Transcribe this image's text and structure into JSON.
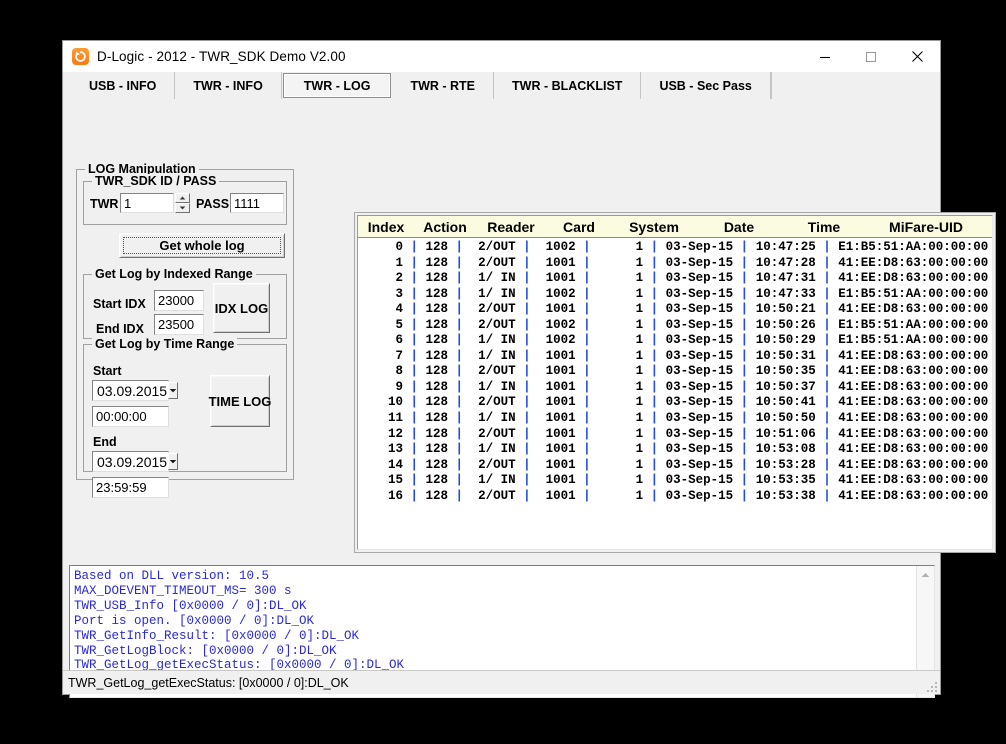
{
  "window": {
    "title": "D-Logic - 2012  - TWR_SDK Demo V2.00",
    "icon": "refresh-circle-icon",
    "minimize_label": "minimize-icon",
    "maximize_label": "maximize-icon",
    "close_label": "close-icon"
  },
  "tabs": [
    {
      "label": "USB - INFO",
      "selected": false
    },
    {
      "label": "TWR - INFO",
      "selected": false
    },
    {
      "label": "TWR - LOG",
      "selected": true
    },
    {
      "label": "TWR - RTE",
      "selected": false
    },
    {
      "label": "TWR - BLACKLIST",
      "selected": false
    },
    {
      "label": "USB - Sec Pass",
      "selected": false
    }
  ],
  "log_manipulation": {
    "title": "LOG Manipulation",
    "id_pass": {
      "title": "TWR_SDK ID / PASS",
      "twr_label": "TWR",
      "twr_value": "1",
      "pass_label": "PASS",
      "pass_value": "1111"
    },
    "get_whole_log_label": "Get whole log",
    "indexed_range": {
      "title": "Get Log by Indexed Range",
      "start_label": "Start IDX",
      "start_value": "23000",
      "end_label": "End IDX",
      "end_value": "23500",
      "button_label": "IDX LOG"
    },
    "time_range": {
      "title": "Get Log by Time Range",
      "start_label": "Start",
      "start_date": "03.09.2015",
      "start_time": "00:00:00",
      "end_label": "End",
      "end_date": "03.09.2015",
      "end_time": "23:59:59",
      "button_label": "TIME LOG"
    }
  },
  "table": {
    "columns": [
      "Index",
      "Action",
      "Reader",
      "Card",
      "System",
      "Date",
      "Time",
      "MiFare-UID"
    ],
    "rows": [
      {
        "index": "0",
        "action": "128",
        "reader": "2/OUT",
        "card": "1002",
        "system": "1",
        "date": "03-Sep-15",
        "time": "10:47:25",
        "uid": "E1:B5:51:AA:00:00:00"
      },
      {
        "index": "1",
        "action": "128",
        "reader": "2/OUT",
        "card": "1001",
        "system": "1",
        "date": "03-Sep-15",
        "time": "10:47:28",
        "uid": "41:EE:D8:63:00:00:00"
      },
      {
        "index": "2",
        "action": "128",
        "reader": "1/ IN",
        "card": "1001",
        "system": "1",
        "date": "03-Sep-15",
        "time": "10:47:31",
        "uid": "41:EE:D8:63:00:00:00"
      },
      {
        "index": "3",
        "action": "128",
        "reader": "1/ IN",
        "card": "1002",
        "system": "1",
        "date": "03-Sep-15",
        "time": "10:47:33",
        "uid": "E1:B5:51:AA:00:00:00"
      },
      {
        "index": "4",
        "action": "128",
        "reader": "2/OUT",
        "card": "1001",
        "system": "1",
        "date": "03-Sep-15",
        "time": "10:50:21",
        "uid": "41:EE:D8:63:00:00:00"
      },
      {
        "index": "5",
        "action": "128",
        "reader": "2/OUT",
        "card": "1002",
        "system": "1",
        "date": "03-Sep-15",
        "time": "10:50:26",
        "uid": "E1:B5:51:AA:00:00:00"
      },
      {
        "index": "6",
        "action": "128",
        "reader": "1/ IN",
        "card": "1002",
        "system": "1",
        "date": "03-Sep-15",
        "time": "10:50:29",
        "uid": "E1:B5:51:AA:00:00:00"
      },
      {
        "index": "7",
        "action": "128",
        "reader": "1/ IN",
        "card": "1001",
        "system": "1",
        "date": "03-Sep-15",
        "time": "10:50:31",
        "uid": "41:EE:D8:63:00:00:00"
      },
      {
        "index": "8",
        "action": "128",
        "reader": "2/OUT",
        "card": "1001",
        "system": "1",
        "date": "03-Sep-15",
        "time": "10:50:35",
        "uid": "41:EE:D8:63:00:00:00"
      },
      {
        "index": "9",
        "action": "128",
        "reader": "1/ IN",
        "card": "1001",
        "system": "1",
        "date": "03-Sep-15",
        "time": "10:50:37",
        "uid": "41:EE:D8:63:00:00:00"
      },
      {
        "index": "10",
        "action": "128",
        "reader": "2/OUT",
        "card": "1001",
        "system": "1",
        "date": "03-Sep-15",
        "time": "10:50:41",
        "uid": "41:EE:D8:63:00:00:00"
      },
      {
        "index": "11",
        "action": "128",
        "reader": "1/ IN",
        "card": "1001",
        "system": "1",
        "date": "03-Sep-15",
        "time": "10:50:50",
        "uid": "41:EE:D8:63:00:00:00"
      },
      {
        "index": "12",
        "action": "128",
        "reader": "2/OUT",
        "card": "1001",
        "system": "1",
        "date": "03-Sep-15",
        "time": "10:51:06",
        "uid": "41:EE:D8:63:00:00:00"
      },
      {
        "index": "13",
        "action": "128",
        "reader": "1/ IN",
        "card": "1001",
        "system": "1",
        "date": "03-Sep-15",
        "time": "10:53:08",
        "uid": "41:EE:D8:63:00:00:00"
      },
      {
        "index": "14",
        "action": "128",
        "reader": "2/OUT",
        "card": "1001",
        "system": "1",
        "date": "03-Sep-15",
        "time": "10:53:28",
        "uid": "41:EE:D8:63:00:00:00"
      },
      {
        "index": "15",
        "action": "128",
        "reader": "1/ IN",
        "card": "1001",
        "system": "1",
        "date": "03-Sep-15",
        "time": "10:53:35",
        "uid": "41:EE:D8:63:00:00:00"
      },
      {
        "index": "16",
        "action": "128",
        "reader": "2/OUT",
        "card": "1001",
        "system": "1",
        "date": "03-Sep-15",
        "time": "10:53:38",
        "uid": "41:EE:D8:63:00:00:00"
      }
    ]
  },
  "console": {
    "lines": [
      "Based on DLL version: 10.5",
      "MAX_DOEVENT_TIMEOUT_MS= 300 s",
      "TWR_USB_Info [0x0000 / 0]:DL_OK",
      "Port is open. [0x0000 / 0]:DL_OK",
      "TWR_GetInfo_Result: [0x0000 / 0]:DL_OK",
      "TWR_GetLogBlock: [0x0000 / 0]:DL_OK",
      "TWR_GetLog_getExecStatus: [0x0000 / 0]:DL_OK"
    ],
    "scroll_up_icon": "chevron-up-icon",
    "scroll_down_icon": "chevron-down-icon"
  },
  "status_bar": {
    "text": "TWR_GetLog_getExecStatus: [0x0000 / 0]:DL_OK"
  },
  "colors": {
    "accent_orange": "#f57c17",
    "console_blue": "#2a2ad0",
    "separator_blue": "#2a4fd6",
    "header_yellow": "#fbfbe0",
    "window_gray": "#f0f0f0"
  }
}
